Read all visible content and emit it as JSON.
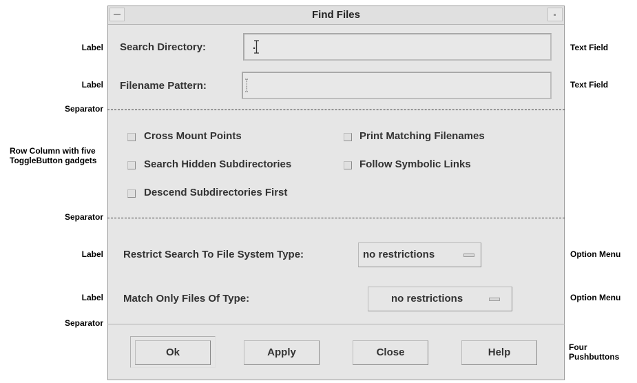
{
  "window": {
    "title": "Find Files"
  },
  "fields": [
    {
      "label": "Search Directory:",
      "value": "."
    },
    {
      "label": "Filename Pattern:",
      "value": ""
    }
  ],
  "toggles": [
    "Cross Mount Points",
    "Print Matching Filenames",
    "Search Hidden Subdirectories",
    "Follow Symbolic Links",
    "Descend Subdirectories First"
  ],
  "options": [
    {
      "label": "Restrict Search To File System Type:",
      "value": "no restrictions"
    },
    {
      "label": "Match Only Files Of Type:",
      "value": "no restrictions"
    }
  ],
  "buttons": [
    "Ok",
    "Apply",
    "Close",
    "Help"
  ],
  "annotations": {
    "label": "Label",
    "separator": "Separator",
    "text_field": "Text Field",
    "row_column": "Row Column with five ToggleButton gadgets",
    "option_menu": "Option Menu",
    "pushbuttons": "Four Pushbuttons"
  }
}
